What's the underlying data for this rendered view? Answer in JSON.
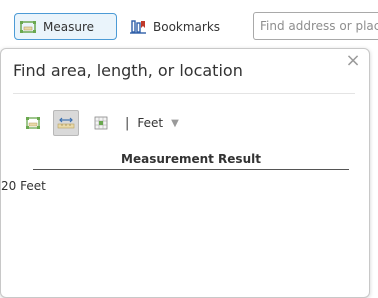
{
  "toolbar": {
    "measure_label": "Measure",
    "bookmarks_label": "Bookmarks",
    "search_placeholder": "Find address or place"
  },
  "panel": {
    "title": "Find area, length, or location",
    "close_glyph": "×",
    "tools": [
      {
        "name": "area",
        "active": false
      },
      {
        "name": "distance",
        "active": true
      },
      {
        "name": "location",
        "active": false
      }
    ],
    "separator": "|",
    "unit_selected": "Feet",
    "result_header": "Measurement Result",
    "result_value": "20 Feet"
  },
  "colors": {
    "accent_border": "#4c9bd6",
    "icon_green": "#6aa84f",
    "icon_red": "#c0392b"
  }
}
